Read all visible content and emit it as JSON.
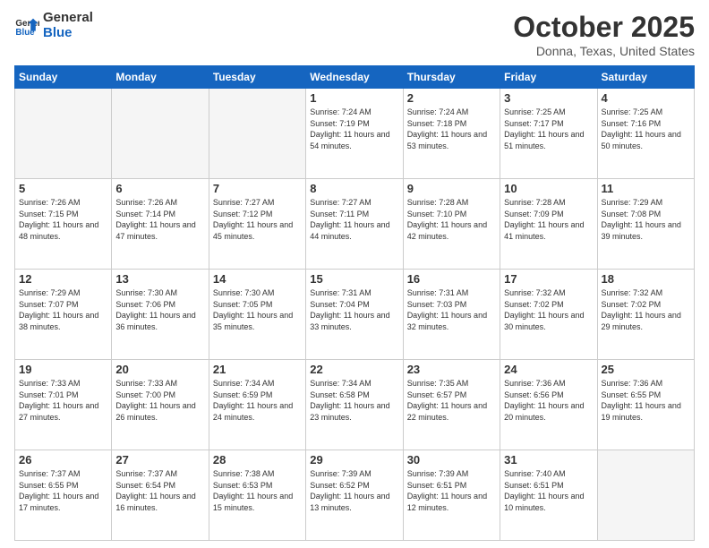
{
  "header": {
    "logo_general": "General",
    "logo_blue": "Blue",
    "month_title": "October 2025",
    "location": "Donna, Texas, United States"
  },
  "weekdays": [
    "Sunday",
    "Monday",
    "Tuesday",
    "Wednesday",
    "Thursday",
    "Friday",
    "Saturday"
  ],
  "weeks": [
    [
      {
        "day": "",
        "empty": true
      },
      {
        "day": "",
        "empty": true
      },
      {
        "day": "",
        "empty": true
      },
      {
        "day": "1",
        "sunrise": "7:24 AM",
        "sunset": "7:19 PM",
        "daylight": "11 hours and 54 minutes."
      },
      {
        "day": "2",
        "sunrise": "7:24 AM",
        "sunset": "7:18 PM",
        "daylight": "11 hours and 53 minutes."
      },
      {
        "day": "3",
        "sunrise": "7:25 AM",
        "sunset": "7:17 PM",
        "daylight": "11 hours and 51 minutes."
      },
      {
        "day": "4",
        "sunrise": "7:25 AM",
        "sunset": "7:16 PM",
        "daylight": "11 hours and 50 minutes."
      }
    ],
    [
      {
        "day": "5",
        "sunrise": "7:26 AM",
        "sunset": "7:15 PM",
        "daylight": "11 hours and 48 minutes."
      },
      {
        "day": "6",
        "sunrise": "7:26 AM",
        "sunset": "7:14 PM",
        "daylight": "11 hours and 47 minutes."
      },
      {
        "day": "7",
        "sunrise": "7:27 AM",
        "sunset": "7:12 PM",
        "daylight": "11 hours and 45 minutes."
      },
      {
        "day": "8",
        "sunrise": "7:27 AM",
        "sunset": "7:11 PM",
        "daylight": "11 hours and 44 minutes."
      },
      {
        "day": "9",
        "sunrise": "7:28 AM",
        "sunset": "7:10 PM",
        "daylight": "11 hours and 42 minutes."
      },
      {
        "day": "10",
        "sunrise": "7:28 AM",
        "sunset": "7:09 PM",
        "daylight": "11 hours and 41 minutes."
      },
      {
        "day": "11",
        "sunrise": "7:29 AM",
        "sunset": "7:08 PM",
        "daylight": "11 hours and 39 minutes."
      }
    ],
    [
      {
        "day": "12",
        "sunrise": "7:29 AM",
        "sunset": "7:07 PM",
        "daylight": "11 hours and 38 minutes."
      },
      {
        "day": "13",
        "sunrise": "7:30 AM",
        "sunset": "7:06 PM",
        "daylight": "11 hours and 36 minutes."
      },
      {
        "day": "14",
        "sunrise": "7:30 AM",
        "sunset": "7:05 PM",
        "daylight": "11 hours and 35 minutes."
      },
      {
        "day": "15",
        "sunrise": "7:31 AM",
        "sunset": "7:04 PM",
        "daylight": "11 hours and 33 minutes."
      },
      {
        "day": "16",
        "sunrise": "7:31 AM",
        "sunset": "7:03 PM",
        "daylight": "11 hours and 32 minutes."
      },
      {
        "day": "17",
        "sunrise": "7:32 AM",
        "sunset": "7:02 PM",
        "daylight": "11 hours and 30 minutes."
      },
      {
        "day": "18",
        "sunrise": "7:32 AM",
        "sunset": "7:02 PM",
        "daylight": "11 hours and 29 minutes."
      }
    ],
    [
      {
        "day": "19",
        "sunrise": "7:33 AM",
        "sunset": "7:01 PM",
        "daylight": "11 hours and 27 minutes."
      },
      {
        "day": "20",
        "sunrise": "7:33 AM",
        "sunset": "7:00 PM",
        "daylight": "11 hours and 26 minutes."
      },
      {
        "day": "21",
        "sunrise": "7:34 AM",
        "sunset": "6:59 PM",
        "daylight": "11 hours and 24 minutes."
      },
      {
        "day": "22",
        "sunrise": "7:34 AM",
        "sunset": "6:58 PM",
        "daylight": "11 hours and 23 minutes."
      },
      {
        "day": "23",
        "sunrise": "7:35 AM",
        "sunset": "6:57 PM",
        "daylight": "11 hours and 22 minutes."
      },
      {
        "day": "24",
        "sunrise": "7:36 AM",
        "sunset": "6:56 PM",
        "daylight": "11 hours and 20 minutes."
      },
      {
        "day": "25",
        "sunrise": "7:36 AM",
        "sunset": "6:55 PM",
        "daylight": "11 hours and 19 minutes."
      }
    ],
    [
      {
        "day": "26",
        "sunrise": "7:37 AM",
        "sunset": "6:55 PM",
        "daylight": "11 hours and 17 minutes."
      },
      {
        "day": "27",
        "sunrise": "7:37 AM",
        "sunset": "6:54 PM",
        "daylight": "11 hours and 16 minutes."
      },
      {
        "day": "28",
        "sunrise": "7:38 AM",
        "sunset": "6:53 PM",
        "daylight": "11 hours and 15 minutes."
      },
      {
        "day": "29",
        "sunrise": "7:39 AM",
        "sunset": "6:52 PM",
        "daylight": "11 hours and 13 minutes."
      },
      {
        "day": "30",
        "sunrise": "7:39 AM",
        "sunset": "6:51 PM",
        "daylight": "11 hours and 12 minutes."
      },
      {
        "day": "31",
        "sunrise": "7:40 AM",
        "sunset": "6:51 PM",
        "daylight": "11 hours and 10 minutes."
      },
      {
        "day": "",
        "empty": true
      }
    ]
  ]
}
